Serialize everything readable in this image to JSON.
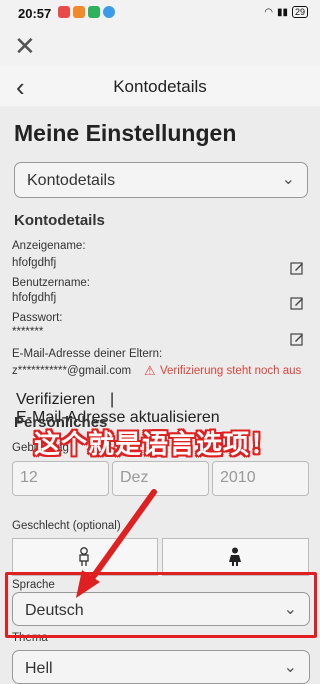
{
  "status": {
    "time": "20:57",
    "battery": "29"
  },
  "header": {
    "title": "Kontodetails"
  },
  "page": {
    "heading": "Meine Einstellungen",
    "account_select": "Kontodetails"
  },
  "account": {
    "section_title": "Kontodetails",
    "display_name_label": "Anzeigename:",
    "display_name_value": "hfofgdhfj",
    "username_label": "Benutzername:",
    "username_value": "hfofgdhfj",
    "password_label": "Passwort:",
    "password_value": "*******",
    "parent_email_label": "E-Mail-Adresse deiner Eltern:",
    "parent_email_value": "z***********@gmail.com",
    "verify_status": "Verifizierung steht noch aus",
    "verify_button": "Verifizieren",
    "separator": "|",
    "update_email": "E-Mail-Adresse aktualisieren"
  },
  "personal": {
    "section_title": "Persönliches",
    "birthday_label": "Geburtstag",
    "day": "12",
    "month": "Dez",
    "year": "2010",
    "gender_label": "Geschlecht (optional)",
    "language_label": "Sprache",
    "language_value": "Deutsch",
    "theme_label": "Thema",
    "theme_value": "Hell"
  },
  "annotation": {
    "text": "这个就是语言选项！"
  },
  "colors": {
    "accent_red": "#e02020",
    "warning": "#d9453b"
  }
}
